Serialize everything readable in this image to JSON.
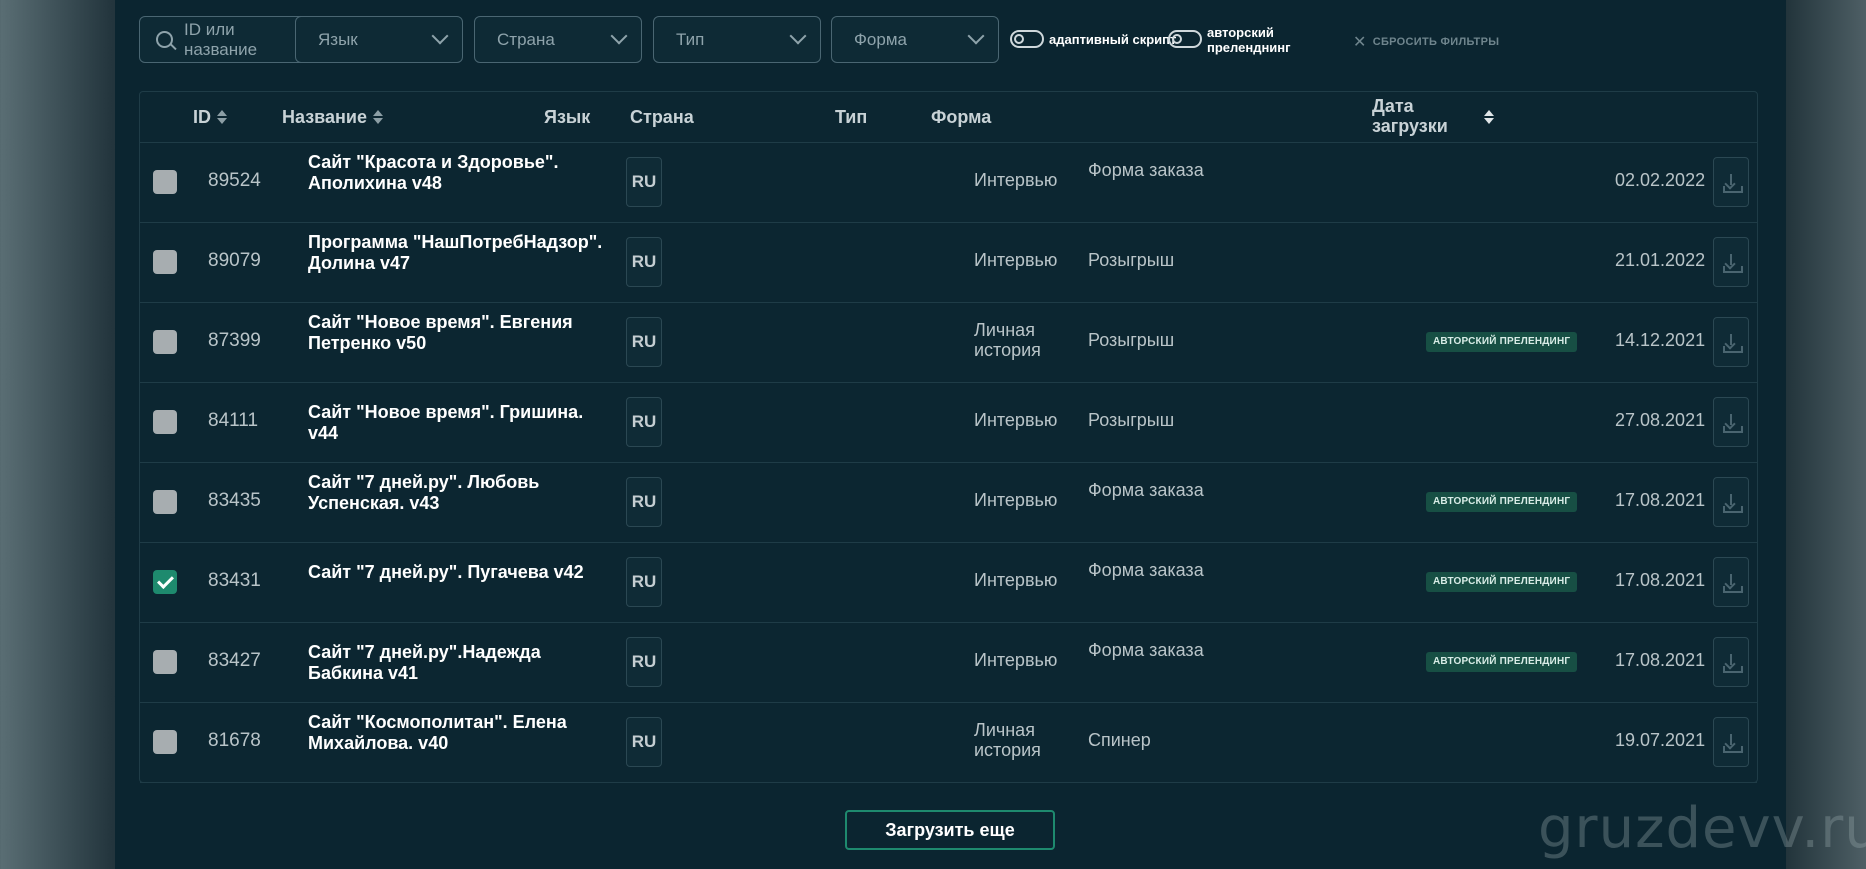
{
  "filters": {
    "search_placeholder": "ID или название",
    "language": "Язык",
    "country": "Страна",
    "type": "Тип",
    "form": "Форма",
    "toggle_adaptive": "адаптивный скрипт",
    "toggle_author_line1": "авторский",
    "toggle_author_line2": "преленднинг",
    "reset": "СБРОСИТЬ ФИЛЬТРЫ"
  },
  "table": {
    "headers": {
      "id": "ID",
      "name": "Название",
      "lang": "Язык",
      "country": "Страна",
      "type": "Тип",
      "form": "Форма",
      "date_line1": "Дата",
      "date_line2": "загрузки"
    },
    "rows": [
      {
        "id": "89524",
        "name": "Сайт \"Красота и Здоровье\". Аполихина v48",
        "lang": "RU",
        "type": "Интервью",
        "form": "Форма заказа",
        "badge": "",
        "date": "02.02.2022",
        "checked": false
      },
      {
        "id": "89079",
        "name": "Программа \"НашПотребНадзор\". Долина v47",
        "lang": "RU",
        "type": "Интервью",
        "form": "Розыгрыш",
        "badge": "",
        "date": "21.01.2022",
        "checked": false
      },
      {
        "id": "87399",
        "name": "Сайт \"Новое время\". Евгения Петренко v50",
        "lang": "RU",
        "type": "Личная история",
        "form": "Розыгрыш",
        "badge": "АВТОРСКИЙ ПРЕЛЕНДИНГ",
        "date": "14.12.2021",
        "checked": false
      },
      {
        "id": "84111",
        "name": "Сайт \"Новое время\". Гришина. v44",
        "lang": "RU",
        "type": "Интервью",
        "form": "Розыгрыш",
        "badge": "",
        "date": "27.08.2021",
        "checked": false
      },
      {
        "id": "83435",
        "name": "Сайт \"7 дней.ру\". Любовь Успенская. v43",
        "lang": "RU",
        "type": "Интервью",
        "form": "Форма заказа",
        "badge": "АВТОРСКИЙ ПРЕЛЕНДИНГ",
        "date": "17.08.2021",
        "checked": false
      },
      {
        "id": "83431",
        "name": "Сайт \"7 дней.ру\". Пугачева v42",
        "lang": "RU",
        "type": "Интервью",
        "form": "Форма заказа",
        "badge": "АВТОРСКИЙ ПРЕЛЕНДИНГ",
        "date": "17.08.2021",
        "checked": true
      },
      {
        "id": "83427",
        "name": "Сайт \"7 дней.ру\".Надежда Бабкина v41",
        "lang": "RU",
        "type": "Интервью",
        "form": "Форма заказа",
        "badge": "АВТОРСКИЙ ПРЕЛЕНДИНГ",
        "date": "17.08.2021",
        "checked": false
      },
      {
        "id": "81678",
        "name": "Сайт \"Космополитан\". Елена Михайлова. v40",
        "lang": "RU",
        "type": "Личная история",
        "form": "Спинер",
        "badge": "",
        "date": "19.07.2021",
        "checked": false
      }
    ]
  },
  "load_more": "Загрузить еще",
  "watermark": "gruzdevv.ru",
  "colors": {
    "accent": "#1e8a6e",
    "panel": "#0b2530",
    "badge": "#174f44"
  }
}
